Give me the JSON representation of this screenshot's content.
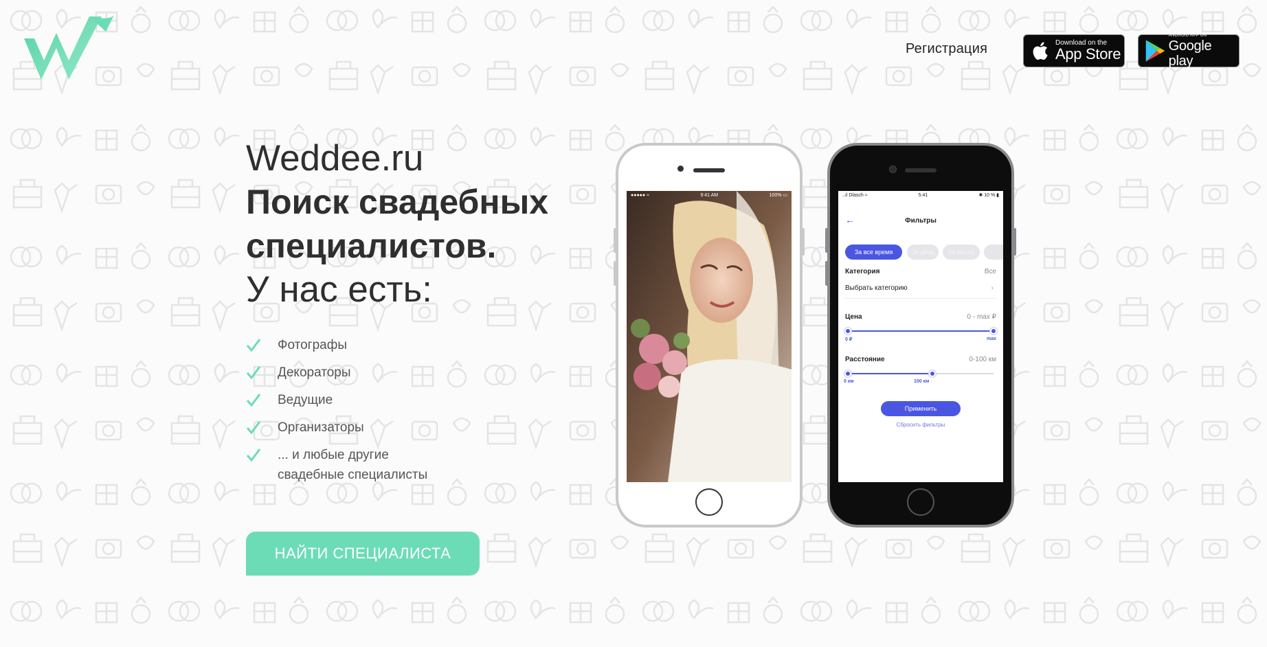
{
  "header": {
    "register_label": "Регистрация",
    "appstore": {
      "small": "Download on the",
      "big": "App Store"
    },
    "googleplay": {
      "small": "ANDROID APP ON",
      "big": "Google play"
    }
  },
  "hero": {
    "site": "Weddee.ru",
    "headline_line1": "Поиск свадебных",
    "headline_line2": "специалистов.",
    "subhead": "У нас есть:",
    "features": [
      {
        "line1": "Фотографы",
        "line2": ""
      },
      {
        "line1": "Декораторы",
        "line2": ""
      },
      {
        "line1": "Ведущие",
        "line2": ""
      },
      {
        "line1": "Организаторы",
        "line2": ""
      },
      {
        "line1": "... и любые другие",
        "line2": "свадебные специалисты"
      }
    ],
    "cta_label": "НАЙТИ СПЕЦИАЛИСТА"
  },
  "phone_white": {
    "status": {
      "carrier": "●●●●● ≈",
      "time": "9:41 AM",
      "battery": "100% ▭"
    }
  },
  "phone_black": {
    "status": {
      "carrier": "..ıl Dlasch ≈",
      "time": "5:41",
      "battery": "✱ 10 % ▮"
    },
    "screen_title": "Фильтры",
    "chips": [
      "За все время",
      "За день",
      "За месяц"
    ],
    "category": {
      "label": "Категория",
      "value": "Все",
      "select": "Выбрать категорию"
    },
    "price": {
      "label": "Цена",
      "value": "0 - max ₽",
      "min_label": "0 ₽",
      "max_label": "max",
      "range_fraction": [
        0,
        1
      ]
    },
    "distance": {
      "label": "Расстояние",
      "value": "0-100 км",
      "min_label": "0 км",
      "max_label": "100 км",
      "range_fraction": [
        0,
        0.58
      ]
    },
    "apply_label": "Применить",
    "reset_label": "Сбросить фильтры"
  },
  "colors": {
    "accent": "#6cdcb7",
    "app_primary": "#4a56e2",
    "text": "#2f2f2f"
  }
}
